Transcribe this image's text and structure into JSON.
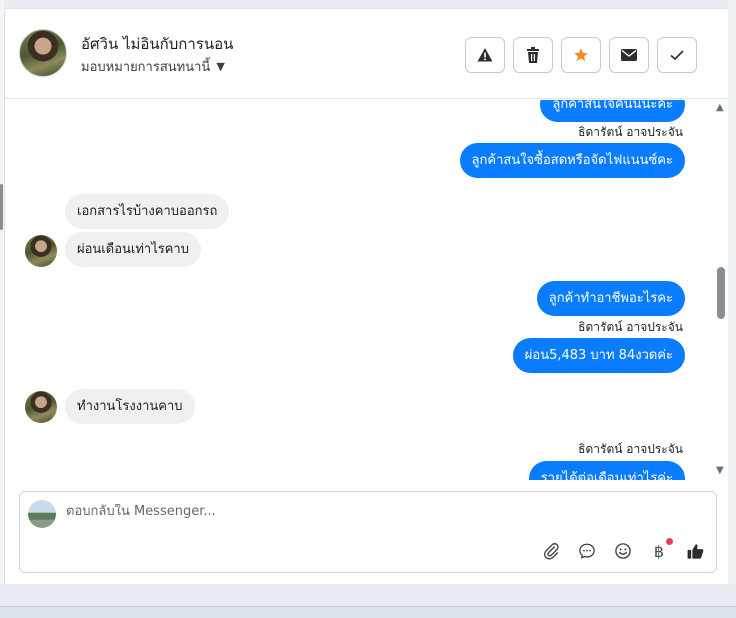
{
  "header": {
    "contact_name": "อัศวิน ไม่อินกับการนอน",
    "assign_label": "มอบหมายการสนทนานี้",
    "actions": [
      {
        "name": "report-button",
        "icon": "warning-icon"
      },
      {
        "name": "delete-button",
        "icon": "trash-icon"
      },
      {
        "name": "star-button",
        "icon": "star-icon"
      },
      {
        "name": "mark-unread-button",
        "icon": "envelope-icon"
      },
      {
        "name": "mark-done-button",
        "icon": "check-icon"
      }
    ]
  },
  "messages": [
    {
      "dir": "out",
      "text": "ลูกค้าสนใจคันนี้นะคะ"
    },
    {
      "dir": "sender",
      "text": "ธิดารัตน์ อาจประจัน"
    },
    {
      "dir": "out",
      "text": "ลูกค้าสนใจซื้อสดหรือจัดไฟแนนซ์คะ"
    },
    {
      "dir": "in",
      "text": "เอกสารไรบ้างคาบออกรถ"
    },
    {
      "dir": "in",
      "text": "ผ่อนเดือนเท่าไรคาบ"
    },
    {
      "dir": "out",
      "text": "ลูกค้าทำอาชีพอะไรคะ"
    },
    {
      "dir": "sender",
      "text": "ธิดารัตน์ อาจประจัน"
    },
    {
      "dir": "out",
      "text": "ผ่อน5,483 บาท 84งวดค่ะ"
    },
    {
      "dir": "in",
      "text": "ทำงานโรงงานคาบ"
    },
    {
      "dir": "sender",
      "text": "ธิดารัตน์ อาจประจัน"
    },
    {
      "dir": "out",
      "text": "รายได้ต่อเดือนเท่าไรค่ะ"
    }
  ],
  "composer": {
    "placeholder": "ตอบกลับใน Messenger..."
  },
  "colors": {
    "outgoing_bubble": "#0a7cff",
    "incoming_bubble": "#eef0f2",
    "star": "#f08a24"
  }
}
